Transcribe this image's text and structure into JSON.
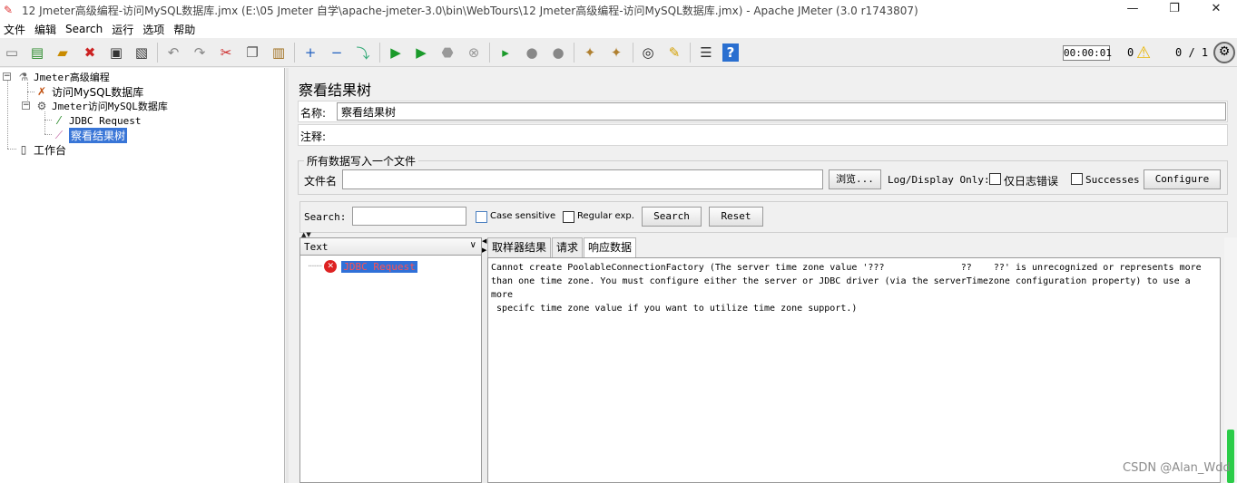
{
  "window": {
    "title": "12 Jmeter高级编程-访问MySQL数据库.jmx (E:\\05 Jmeter 自学\\apache-jmeter-3.0\\bin\\WebTours\\12 Jmeter高级编程-访问MySQL数据库.jmx) - Apache JMeter (3.0 r1743807)",
    "min": "—",
    "max": "❐",
    "close": "✕"
  },
  "menu": [
    "文件",
    "编辑",
    "Search",
    "运行",
    "选项",
    "帮助"
  ],
  "toolbar": {
    "timer": "00:00:01",
    "error_count": "0",
    "threads": "0 / 1"
  },
  "tree": {
    "root": "Jmeter高级编程",
    "config": "访问MySQL数据库",
    "thread_group": "Jmeter访问MySQL数据库",
    "sampler": "JDBC Request",
    "listener": "察看结果树",
    "workbench": "工作台"
  },
  "panel": {
    "title": "察看结果树",
    "name_label": "名称:",
    "name_value": "察看结果树",
    "comment_label": "注释:",
    "file_group_legend": "所有数据写入一个文件",
    "file_label": "文件名",
    "browse_btn": "浏览...",
    "log_display": "Log/Display Only:",
    "errors_only": "仅日志错误",
    "successes": "Successes",
    "configure_btn": "Configure"
  },
  "search": {
    "label": "Search:",
    "case_sensitive": "Case sensitive",
    "regular_exp": "Regular exp.",
    "search_btn": "Search",
    "reset_btn": "Reset"
  },
  "results": {
    "renderer": "Text",
    "item": "JDBC Request",
    "tabs": [
      "取样器结果",
      "请求",
      "响应数据"
    ],
    "response_text": "Cannot create PoolableConnectionFactory (The server time zone value '???              ??    ??' is unrecognized or represents more\nthan one time zone. You must configure either the server or JDBC driver (via the serverTimezone configuration property) to use a more\n specifc time zone value if you want to utilize time zone support.)"
  },
  "watermark": "CSDN @Alan_Wdd",
  "colors": {
    "selection": "#3875d7",
    "error": "#d22222",
    "scroll_thumb": "#2bcc48"
  }
}
